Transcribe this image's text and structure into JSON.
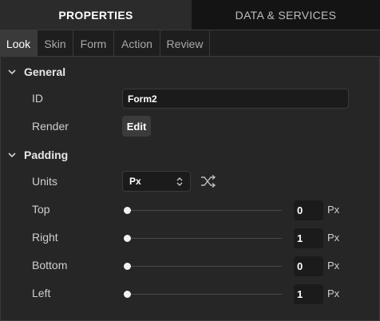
{
  "top_tabs": [
    {
      "label": "PROPERTIES",
      "active": true
    },
    {
      "label": "DATA & SERVICES",
      "active": false
    }
  ],
  "sub_tabs": [
    {
      "label": "Look",
      "active": true
    },
    {
      "label": "Skin",
      "active": false
    },
    {
      "label": "Form",
      "active": false
    },
    {
      "label": "Action",
      "active": false
    },
    {
      "label": "Review",
      "active": false
    }
  ],
  "general": {
    "title": "General",
    "expanded": true,
    "id_label": "ID",
    "id_value": "Form2",
    "render_label": "Render",
    "render_button": "Edit"
  },
  "padding": {
    "title": "Padding",
    "expanded": true,
    "units_label": "Units",
    "units_value": "Px",
    "shuffle_icon": "shuffle-icon",
    "rows": [
      {
        "label": "Top",
        "value": "0",
        "unit": "Px",
        "slider_level": 0
      },
      {
        "label": "Right",
        "value": "1",
        "unit": "Px",
        "slider_level": 0
      },
      {
        "label": "Bottom",
        "value": "0",
        "unit": "Px",
        "slider_level": 0
      },
      {
        "label": "Left",
        "value": "1",
        "unit": "Px",
        "slider_level": 0
      }
    ]
  },
  "colors": {
    "panel_bg": "#262626",
    "active_tab_bg": "#2b2b2b",
    "inactive_tab_bg": "#141414",
    "field_bg": "#1b1b1b",
    "accent_text": "#ffffff"
  }
}
